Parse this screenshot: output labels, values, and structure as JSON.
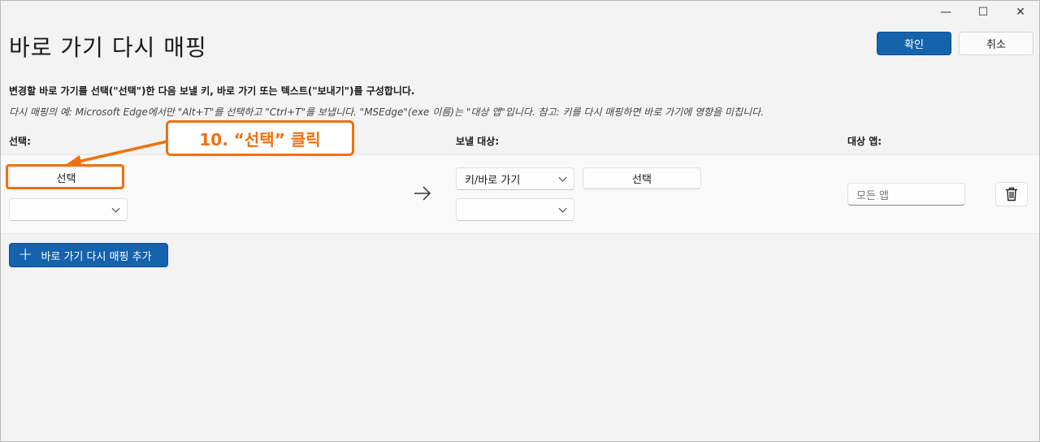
{
  "window": {
    "caption": {
      "minimize_glyph": "—",
      "maximize_glyph": "☐",
      "close_glyph": "✕"
    }
  },
  "header": {
    "title": "바로 가기 다시 매핑",
    "ok_label": "확인",
    "cancel_label": "취소"
  },
  "description": {
    "instruction": "변경할 바로 가기를 선택(\"선택\")한 다음 보낼 키, 바로 가기 또는 텍스트(\"보내기\")를 구성합니다.",
    "example": "다시 매핑의 예: Microsoft Edge에서만 \"Alt+T\"를 선택하고 \"Ctrl+T\"를 보냅니다. \"MSEdge\"(exe 이름)는 \"대상 앱\"입니다. 참고: 키를 다시 매핑하면 바로 가기에 영향을 미칩니다."
  },
  "columns": {
    "select": "선택:",
    "send_to": "보낼 대상:",
    "target_app": "대상 앱:"
  },
  "mapping": {
    "select_button_label": "선택",
    "select_combo_value": "",
    "send_type_value": "키/바로 가기",
    "send_select_button_label": "선택",
    "send_combo_value": "",
    "target_app_placeholder": "모든 앱"
  },
  "footer": {
    "add_button_label": "바로 가기 다시 매핑 추가"
  },
  "annotation": {
    "callout_text": "10. “선택” 클릭",
    "accent_color": "#f07010"
  },
  "colors": {
    "primary": "#1562ad",
    "background": "#f3f3f3"
  },
  "icons": {
    "arrow": "arrow-right-icon",
    "delete": "trash-icon",
    "add": "plus-icon"
  }
}
